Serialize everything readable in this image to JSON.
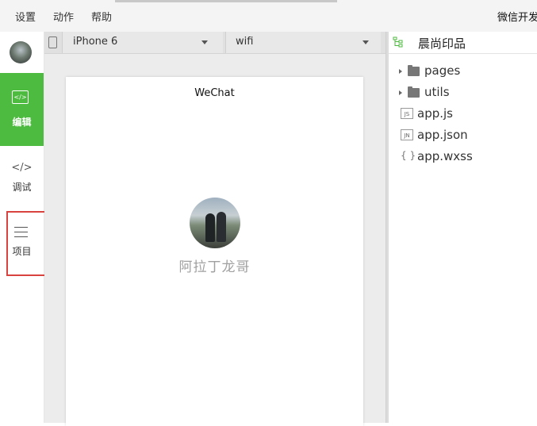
{
  "menu": {
    "items": [
      "设置",
      "动作",
      "帮助"
    ],
    "app_title": "微信开发"
  },
  "sidebar": {
    "items": [
      {
        "label": "编辑",
        "icon": "code-icon",
        "active": true
      },
      {
        "label": "调试",
        "icon": "debug-code-icon",
        "glyph": "</>"
      },
      {
        "label": "项目",
        "icon": "menu-lines-icon"
      }
    ],
    "edit_icon_glyph": "</>"
  },
  "simulator": {
    "device": "iPhone 6",
    "network": "wifi",
    "nav_title": "WeChat",
    "nickname": "阿拉丁龙哥"
  },
  "files": {
    "project_name": "晨尚印品",
    "tree": [
      {
        "name": "pages",
        "type": "folder"
      },
      {
        "name": "utils",
        "type": "folder"
      },
      {
        "name": "app.js",
        "type": "file",
        "badge": "JS"
      },
      {
        "name": "app.json",
        "type": "file",
        "badge": "JN"
      },
      {
        "name": "app.wxss",
        "type": "file",
        "badge": "{ }"
      }
    ]
  },
  "colors": {
    "accent": "#4cbb3f",
    "highlight": "#d9433f"
  }
}
